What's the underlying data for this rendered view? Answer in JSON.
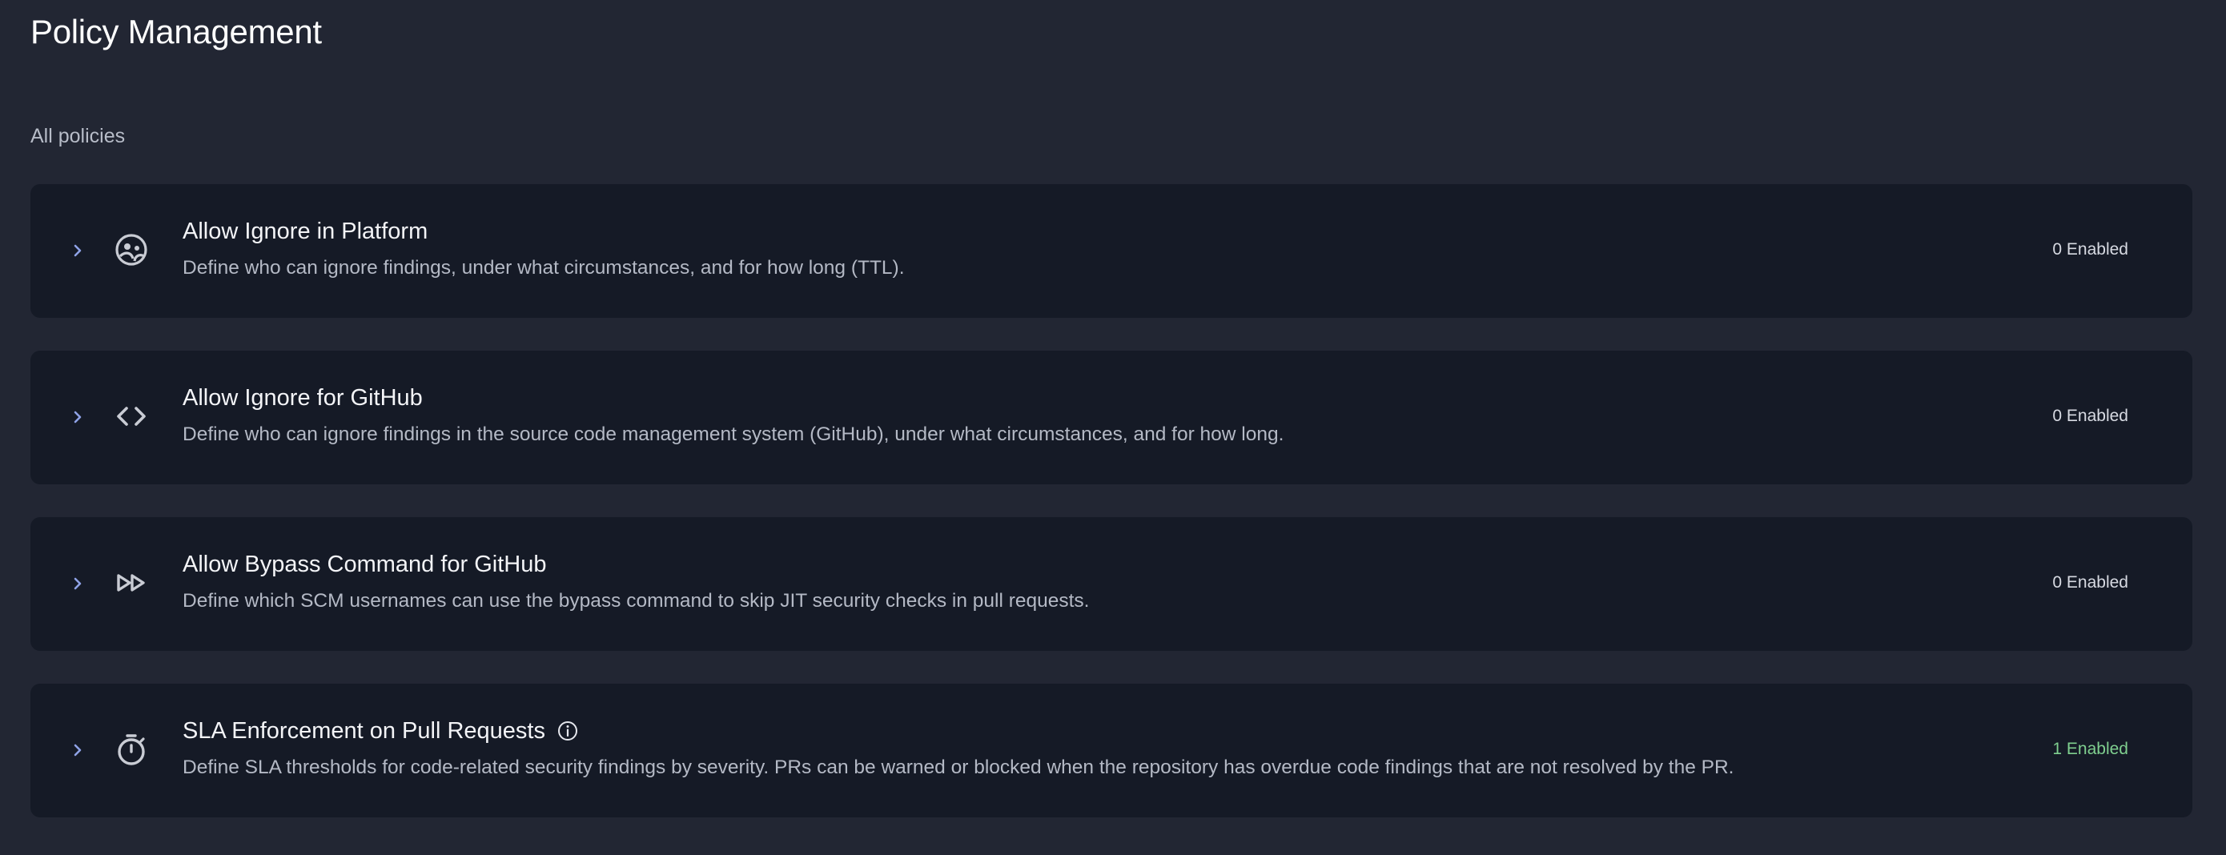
{
  "page": {
    "title": "Policy Management",
    "section_label": "All policies"
  },
  "policies": [
    {
      "icon": "user-face-icon",
      "title": "Allow Ignore in Platform",
      "description": "Define who can ignore findings, under what circumstances, and for how long (TTL).",
      "status": "0 Enabled",
      "has_info": false
    },
    {
      "icon": "code-brackets-icon",
      "title": "Allow Ignore for GitHub",
      "description": "Define who can ignore findings in the source code management system (GitHub), under what circumstances, and for how long.",
      "status": "0 Enabled",
      "has_info": false
    },
    {
      "icon": "fast-forward-icon",
      "title": "Allow Bypass Command for GitHub",
      "description": "Define which SCM usernames can use the bypass command to skip JIT security checks in pull requests.",
      "status": "0 Enabled",
      "has_info": false
    },
    {
      "icon": "stopwatch-icon",
      "title": "SLA Enforcement on Pull Requests",
      "description": "Define SLA thresholds for code-related security findings by severity. PRs can be warned or blocked when the repository has overdue code findings that are not resolved by the PR.",
      "status": "1 Enabled",
      "has_info": true
    }
  ],
  "colors": {
    "background": "#222633",
    "card": "#151a26",
    "chevron": "#8fa2e6",
    "enabled_status": "#7fcf8f",
    "icon": "#c9ccd4"
  }
}
